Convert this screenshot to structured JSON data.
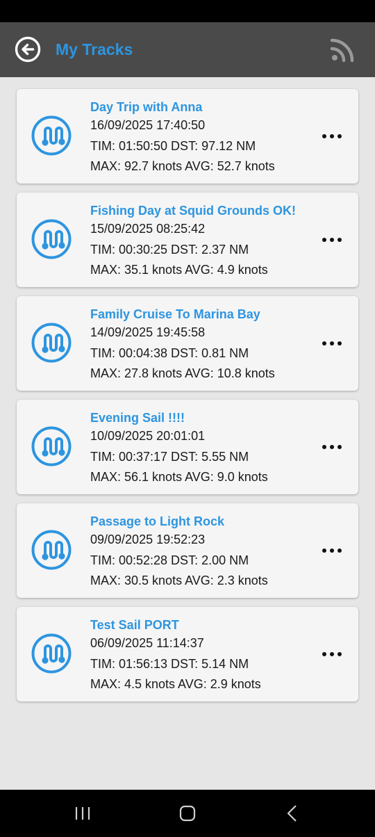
{
  "header": {
    "title": "My Tracks",
    "back_icon": "back-arrow-icon",
    "feed_icon": "rss-icon"
  },
  "colors": {
    "accent": "#2d95e0",
    "toolbar": "#4a4a4a",
    "card": "#f5f5f5",
    "background": "#e6e6e6"
  },
  "tracks": [
    {
      "title": "Day Trip with Anna",
      "date": "16/09/2025 17:40:50",
      "stats": "TIM: 01:50:50  DST: 97.12 NM",
      "speeds": "MAX: 92.7 knots  AVG: 52.7 knots"
    },
    {
      "title": "Fishing Day at Squid Grounds OK!",
      "date": "15/09/2025 08:25:42",
      "stats": "TIM: 00:30:25  DST: 2.37 NM",
      "speeds": "MAX: 35.1 knots  AVG: 4.9 knots"
    },
    {
      "title": "Family Cruise To Marina Bay",
      "date": "14/09/2025 19:45:58",
      "stats": "TIM: 00:04:38  DST: 0.81 NM",
      "speeds": "MAX: 27.8 knots  AVG: 10.8 knots"
    },
    {
      "title": "Evening Sail !!!!",
      "date": "10/09/2025 20:01:01",
      "stats": "TIM: 00:37:17  DST: 5.55 NM",
      "speeds": "MAX: 56.1 knots  AVG: 9.0 knots"
    },
    {
      "title": "Passage to Light Rock",
      "date": "09/09/2025 19:52:23",
      "stats": "TIM: 00:52:28  DST: 2.00 NM",
      "speeds": "MAX: 30.5 knots  AVG: 2.3 knots"
    },
    {
      "title": "Test Sail PORT",
      "date": "06/09/2025 11:14:37",
      "stats": "TIM: 01:56:13  DST: 5.14 NM",
      "speeds": "MAX: 4.5 knots  AVG: 2.9 knots"
    }
  ],
  "navigation": {
    "recents_icon": "recents-icon",
    "home_icon": "home-icon",
    "back_icon": "nav-back-icon"
  }
}
